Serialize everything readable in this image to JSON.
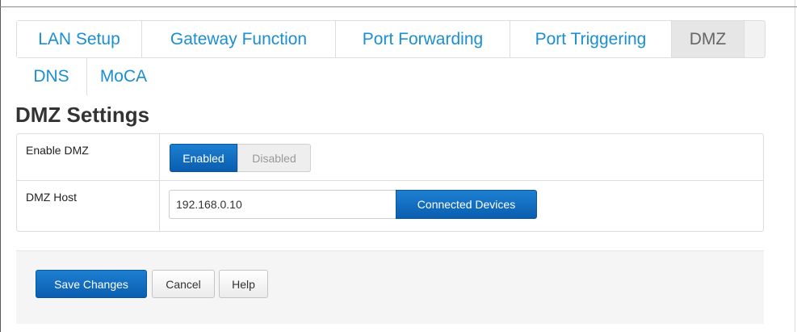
{
  "tabs_row1": [
    {
      "label": "LAN Setup",
      "active": false
    },
    {
      "label": "Gateway Function",
      "active": false
    },
    {
      "label": "Port Forwarding",
      "active": false
    },
    {
      "label": "Port Triggering",
      "active": false
    },
    {
      "label": "DMZ",
      "active": true
    }
  ],
  "tabs_row2": [
    {
      "label": "DNS"
    },
    {
      "label": "MoCA"
    }
  ],
  "page_title": "DMZ Settings",
  "enable_dmz": {
    "label": "Enable DMZ",
    "enabled_label": "Enabled",
    "disabled_label": "Disabled",
    "selected": "Enabled"
  },
  "dmz_host": {
    "label": "DMZ Host",
    "value": "192.168.0.10",
    "connected_devices_label": "Connected Devices"
  },
  "footer": {
    "save_label": "Save Changes",
    "cancel_label": "Cancel",
    "help_label": "Help"
  },
  "colors": {
    "tab_text": "#1b8fd1",
    "primary_button": "#0b6bc4",
    "active_tab_bg": "#e6e6e6"
  }
}
